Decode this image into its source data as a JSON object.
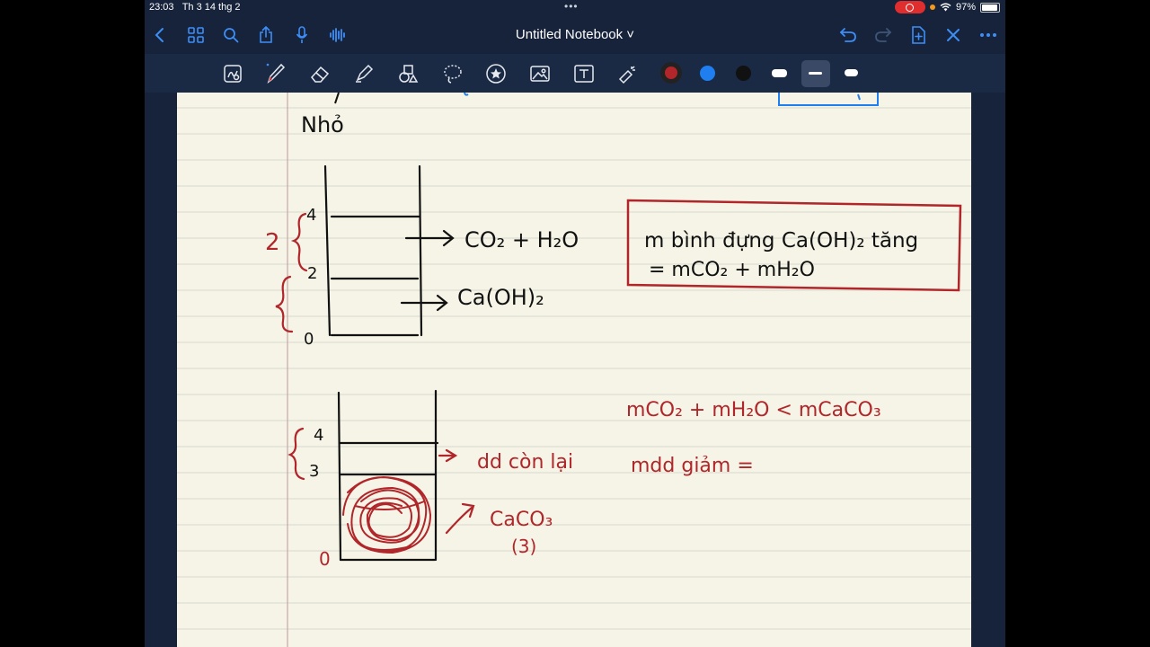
{
  "status": {
    "time": "23:03",
    "date": "Th 3 14 thg 2",
    "battery": "97%"
  },
  "nav": {
    "title": "Untitled Notebook ˅"
  },
  "toolbar": {
    "colors": [
      "#b0262a",
      "#1f7ff0",
      "#111111",
      "#ffffff"
    ]
  },
  "notes": {
    "top_word": "Nhỏ",
    "d1_labels": [
      "4",
      "2",
      "0",
      "2"
    ],
    "d1_out1": "CO₂ + H₂O",
    "d1_out2": "Ca(OH)₂",
    "box_line1": "m bình đựng Ca(OH)₂ tăng",
    "box_line2": "= mCO₂ + mH₂O",
    "d2_labels": [
      "4",
      "3",
      "0"
    ],
    "d2_out1": "dd còn lại",
    "d2_out2": "CaCO₃",
    "d2_out2b": "(3)",
    "rhs_line1": "mCO₂ + mH₂O < mCaCO₃",
    "rhs_line2": "mdd giảm ="
  }
}
